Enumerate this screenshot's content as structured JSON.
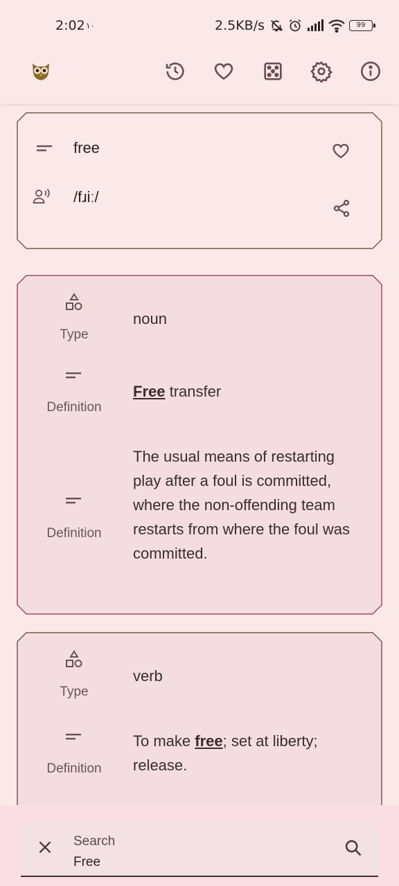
{
  "status_bar": {
    "time": "2:02",
    "extra": "۱۰",
    "net_speed": "2.5KB/s",
    "battery": "99"
  },
  "app_bar": {
    "icons": [
      "owl-logo-icon",
      "history-icon",
      "favorite-icon",
      "dice-icon",
      "settings-icon",
      "info-icon"
    ]
  },
  "word": {
    "text": "free",
    "pronunciation": "/fɹiː/"
  },
  "senses": [
    {
      "type_label": "Type",
      "type_value": "noun",
      "definitions": [
        {
          "label": "Definition",
          "bold": "Free",
          "after": " transfer"
        },
        {
          "label": "Definition",
          "text": "The usual means of restarting play after a foul is committed, where the non-offending team restarts from where the foul was committed."
        }
      ]
    },
    {
      "type_label": "Type",
      "type_value": "verb",
      "definitions": [
        {
          "label": "Definition",
          "before": "To make ",
          "bold": "free",
          "after": "; set at liberty; release."
        }
      ]
    }
  ],
  "search": {
    "label": "Search",
    "value": "Free"
  },
  "colors": {
    "background": "#fbe9e9",
    "card_tint": "#f4dde1",
    "icon": "#6b5050",
    "owl": "#8a6a2a"
  }
}
